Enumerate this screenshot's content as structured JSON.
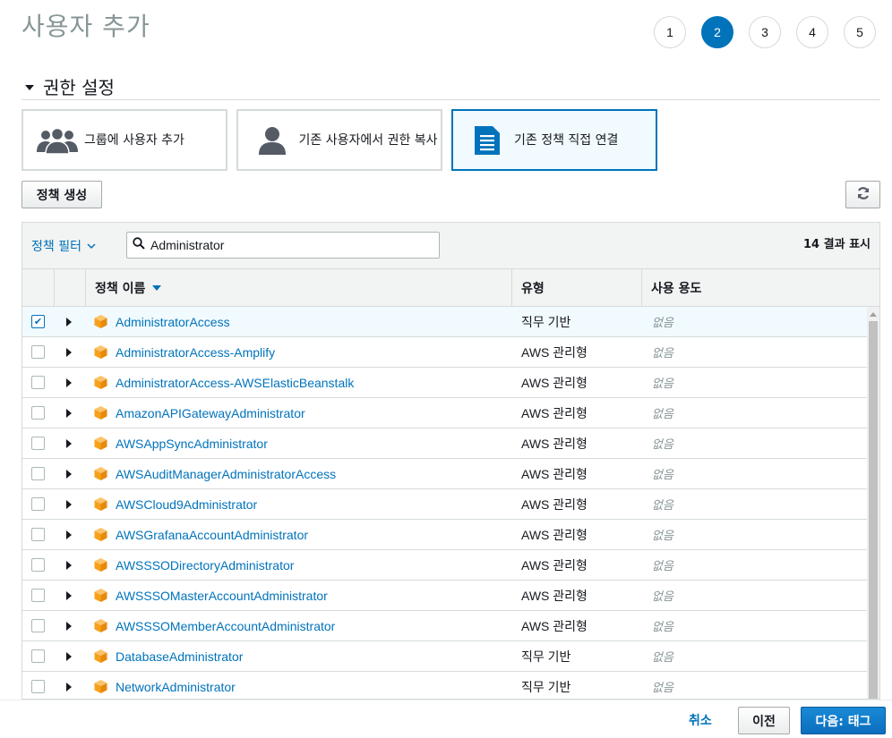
{
  "page": {
    "title": "사용자 추가"
  },
  "steps": [
    "1",
    "2",
    "3",
    "4",
    "5"
  ],
  "active_step": "2",
  "section": {
    "title": "권한 설정"
  },
  "options": [
    {
      "label": "그룹에 사용자 추가",
      "icon": "group-icon"
    },
    {
      "label": "기존 사용자에서 권한 복사",
      "icon": "user-icon"
    },
    {
      "label": "기존 정책 직접 연결",
      "icon": "document-icon"
    }
  ],
  "toolbar": {
    "create_label": "정책 생성",
    "refresh_icon": "refresh-icon"
  },
  "filter": {
    "dropdown_label": "정책 필터",
    "search_value": "Administrator",
    "result_count": "14 결과 표시"
  },
  "columns": {
    "name": "정책 이름",
    "type": "유형",
    "usage": "사용 용도"
  },
  "rows": [
    {
      "name": "AdministratorAccess",
      "type": "직무 기반",
      "usage": "없음",
      "checked": true
    },
    {
      "name": "AdministratorAccess-Amplify",
      "type": "AWS 관리형",
      "usage": "없음",
      "checked": false
    },
    {
      "name": "AdministratorAccess-AWSElasticBeanstalk",
      "type": "AWS 관리형",
      "usage": "없음",
      "checked": false
    },
    {
      "name": "AmazonAPIGatewayAdministrator",
      "type": "AWS 관리형",
      "usage": "없음",
      "checked": false
    },
    {
      "name": "AWSAppSyncAdministrator",
      "type": "AWS 관리형",
      "usage": "없음",
      "checked": false
    },
    {
      "name": "AWSAuditManagerAdministratorAccess",
      "type": "AWS 관리형",
      "usage": "없음",
      "checked": false
    },
    {
      "name": "AWSCloud9Administrator",
      "type": "AWS 관리형",
      "usage": "없음",
      "checked": false
    },
    {
      "name": "AWSGrafanaAccountAdministrator",
      "type": "AWS 관리형",
      "usage": "없음",
      "checked": false
    },
    {
      "name": "AWSSSODirectoryAdministrator",
      "type": "AWS 관리형",
      "usage": "없음",
      "checked": false
    },
    {
      "name": "AWSSSOMasterAccountAdministrator",
      "type": "AWS 관리형",
      "usage": "없음",
      "checked": false
    },
    {
      "name": "AWSSSOMemberAccountAdministrator",
      "type": "AWS 관리형",
      "usage": "없음",
      "checked": false
    },
    {
      "name": "DatabaseAdministrator",
      "type": "직무 기반",
      "usage": "없음",
      "checked": false
    },
    {
      "name": "NetworkAdministrator",
      "type": "직무 기반",
      "usage": "없음",
      "checked": false
    }
  ],
  "footer": {
    "cancel_label": "취소",
    "prev_label": "이전",
    "next_label": "다음: 태그"
  },
  "colors": {
    "accent": "#0073bb",
    "policy_icon": "#f7a11a",
    "muted": "#879596"
  }
}
